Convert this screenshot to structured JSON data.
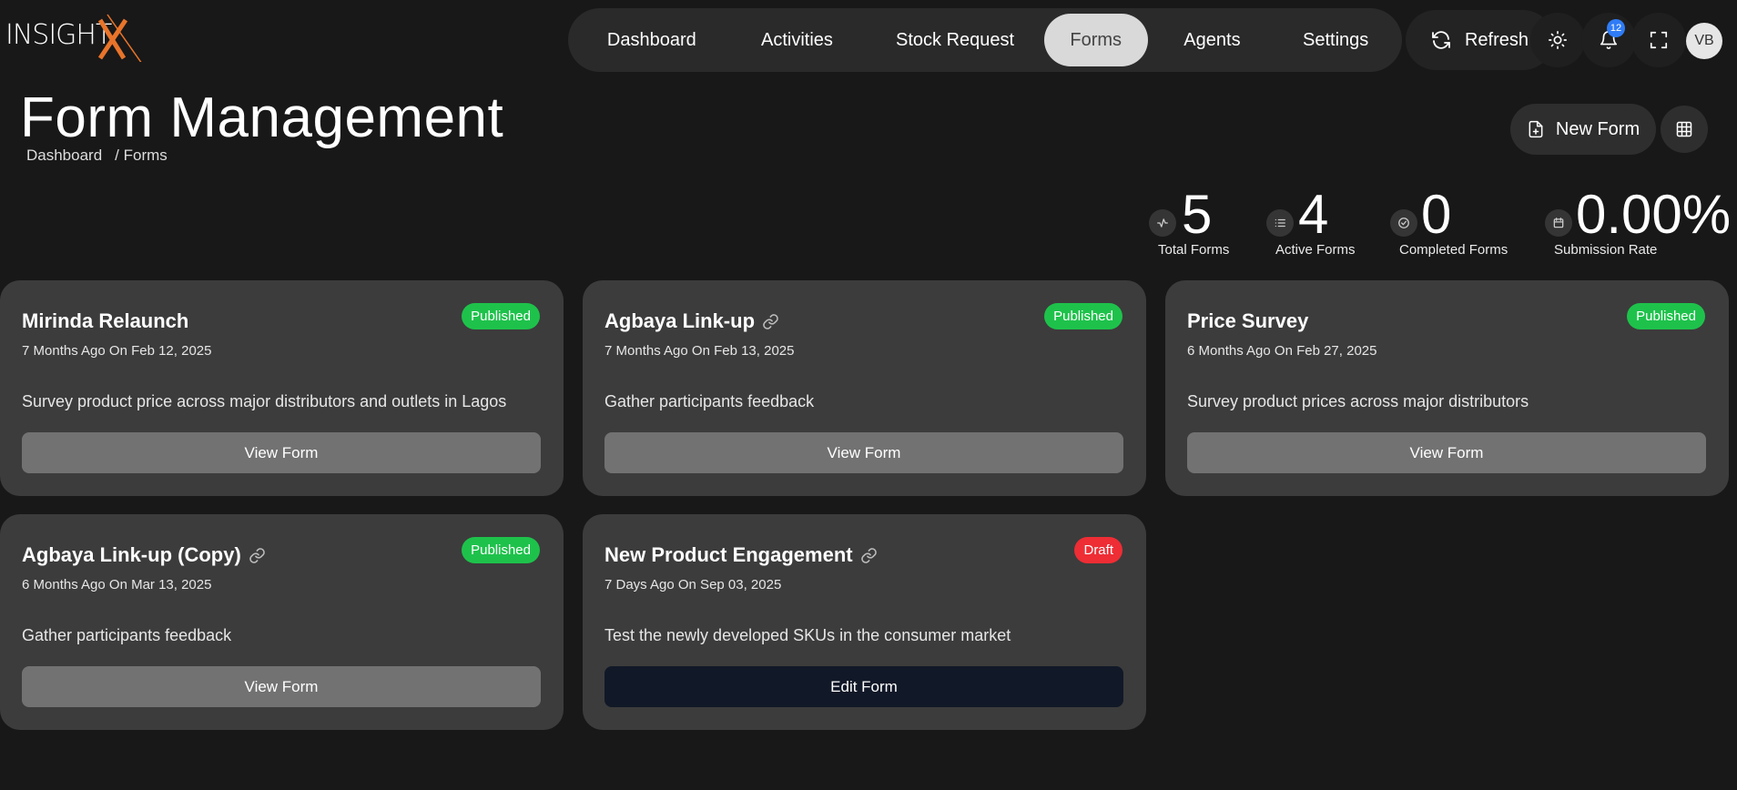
{
  "brand": {
    "logo_text": "INSIGHTX",
    "accent": "#e8742a"
  },
  "nav": {
    "items": [
      {
        "label": "Dashboard",
        "active": false
      },
      {
        "label": "Activities",
        "active": false
      },
      {
        "label": "Stock Request",
        "active": false
      },
      {
        "label": "Forms",
        "active": true
      },
      {
        "label": "Agents",
        "active": false
      },
      {
        "label": "Settings",
        "active": false
      }
    ]
  },
  "toolbar": {
    "refresh_label": "Refresh",
    "refresh_icon": "refresh-icon",
    "theme_icon": "sun-icon",
    "notifications_icon": "bell-icon",
    "notification_count": "12",
    "fullscreen_icon": "expand-icon",
    "avatar_initials": "VB"
  },
  "header": {
    "title": "Form Management",
    "breadcrumb": [
      "Dashboard",
      "/ Forms"
    ],
    "new_form_label": "New Form",
    "grid_icon": "grid-icon"
  },
  "stats": [
    {
      "value": "5",
      "label": "Total Forms",
      "icon": "activity-icon"
    },
    {
      "value": "4",
      "label": "Active Forms",
      "icon": "list-icon"
    },
    {
      "value": "0",
      "label": "Completed Forms",
      "icon": "check-circle-icon"
    },
    {
      "value": "0.00%",
      "label": "Submission Rate",
      "icon": "calendar-icon"
    }
  ],
  "colors": {
    "published": "#1ec24b",
    "draft": "#ee2d35",
    "card_bg": "#3c3c3c",
    "view_button": "#727272",
    "edit_button": "#111827"
  },
  "forms": [
    {
      "title": "Mirinda Relaunch",
      "linked": false,
      "status": "Published",
      "date": "7 Months Ago On Feb 12, 2025",
      "description": "Survey product price across major distributors and outlets in Lagos",
      "action": "View Form"
    },
    {
      "title": "Agbaya Link-up",
      "linked": true,
      "status": "Published",
      "date": "7 Months Ago On Feb 13, 2025",
      "description": "Gather participants feedback",
      "action": "View Form"
    },
    {
      "title": "Price Survey",
      "linked": false,
      "status": "Published",
      "date": "6 Months Ago On Feb 27, 2025",
      "description": "Survey product prices across major distributors",
      "action": "View Form"
    },
    {
      "title": "Agbaya Link-up (Copy)",
      "linked": true,
      "status": "Published",
      "date": "6 Months Ago On Mar 13, 2025",
      "description": "Gather participants feedback",
      "action": "View Form"
    },
    {
      "title": "New Product Engagement",
      "linked": true,
      "status": "Draft",
      "date": "7 Days Ago On Sep 03, 2025",
      "description": "Test the newly developed SKUs in the consumer market",
      "action": "Edit Form"
    }
  ]
}
